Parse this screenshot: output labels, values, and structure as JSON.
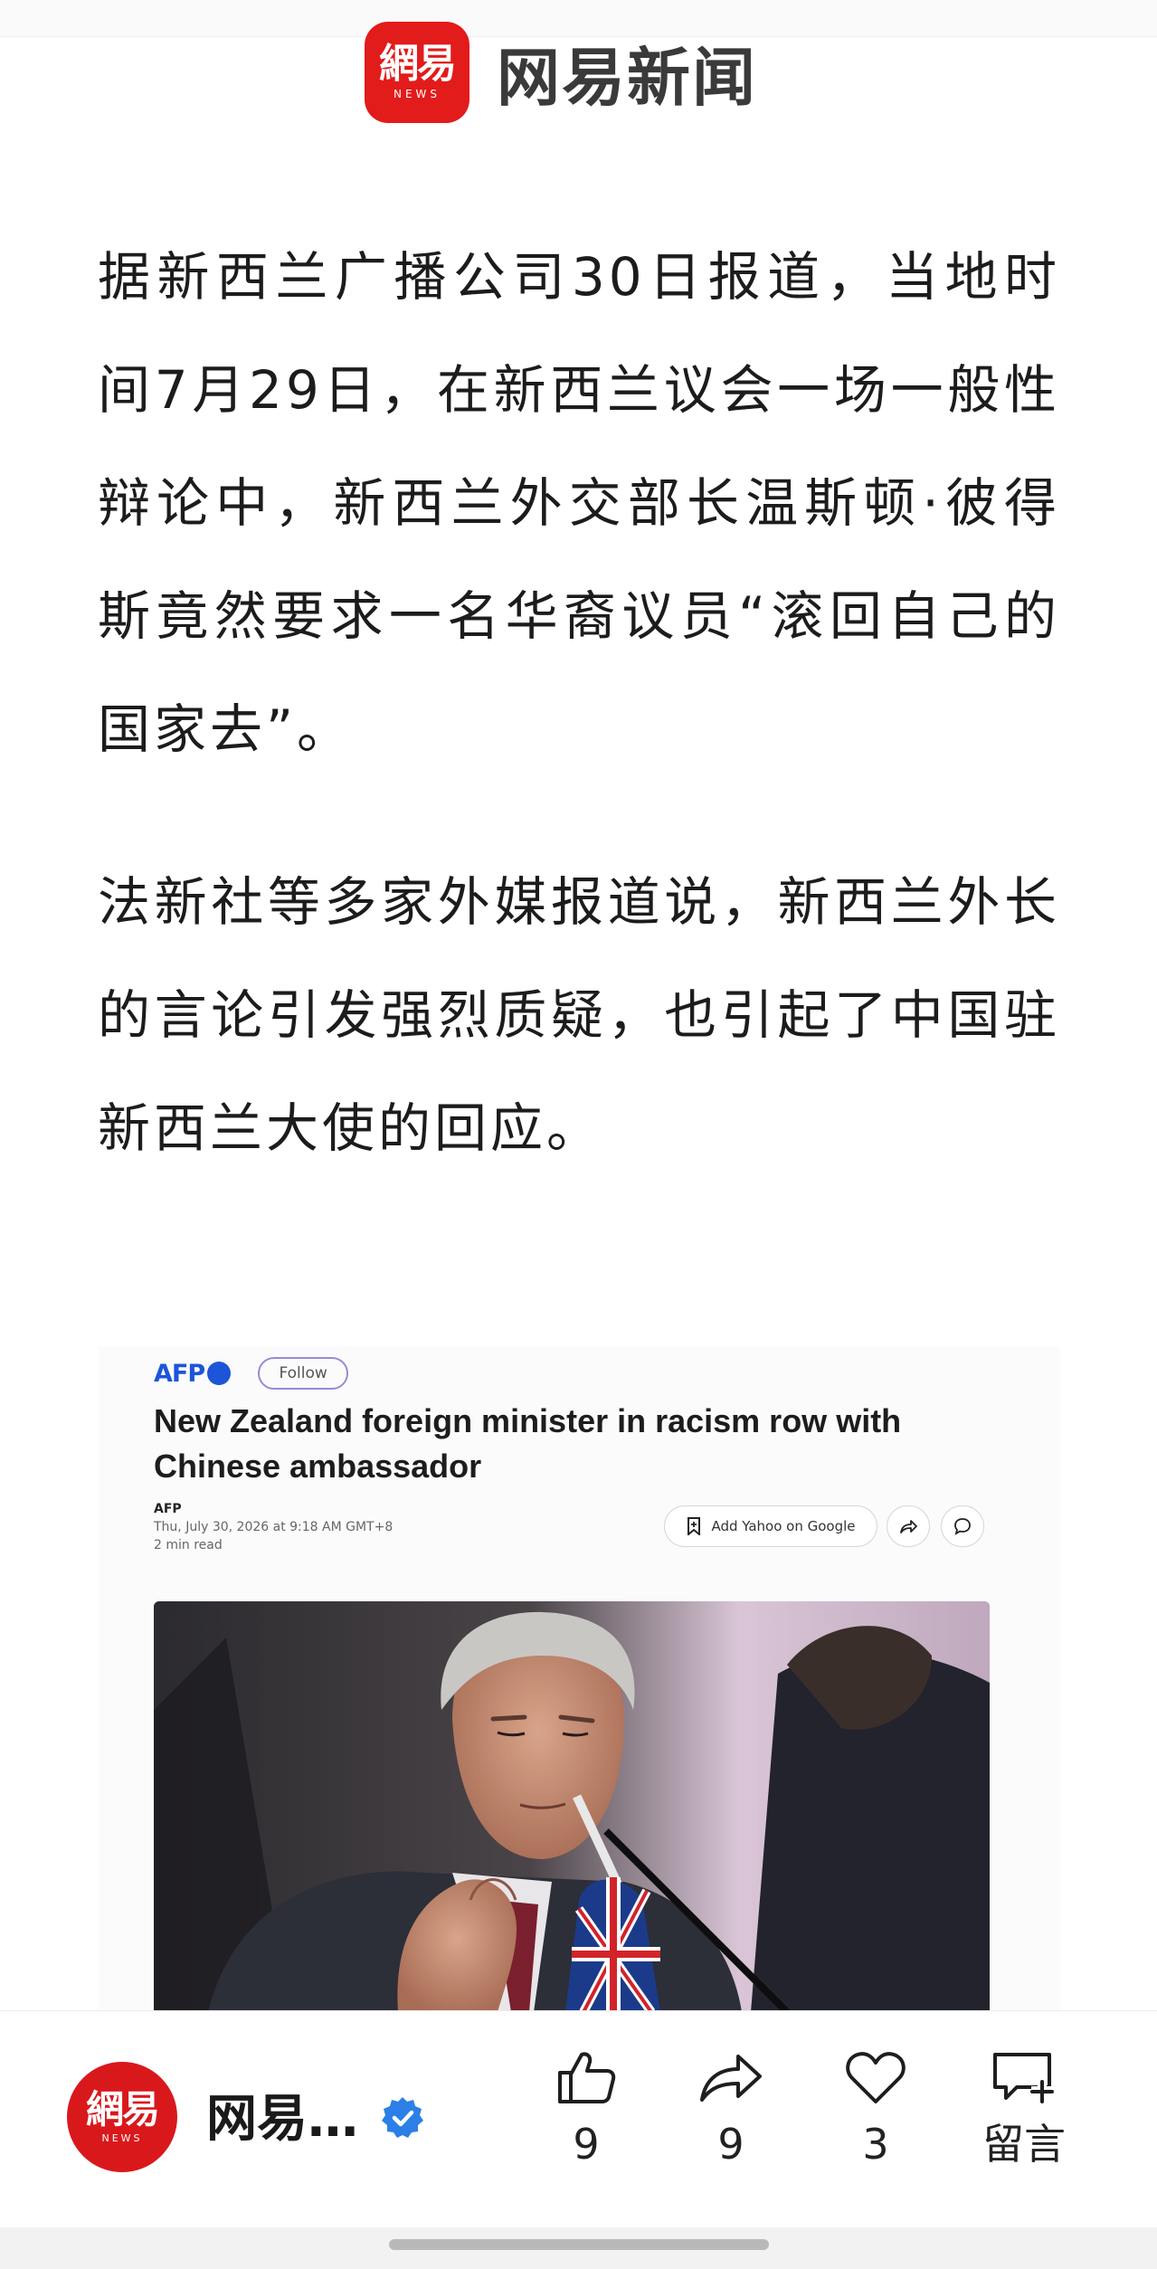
{
  "header": {
    "logo_cn": "網易",
    "logo_en": "NEWS",
    "brand_name": "网易新闻"
  },
  "article": {
    "paragraph_1": "据新西兰广播公司30日报道，当地时间7月29日，在新西兰议会一场一般性辩论中，新西兰外交部长温斯顿·彼得斯竟然要求一名华裔议员“滚回自己的国家去”。",
    "paragraph_2": "法新社等多家外媒报道说，新西兰外长的言论引发强烈质疑，也引起了中国驻新西兰大使的回应。"
  },
  "embedded_screenshot": {
    "publisher_logo": "AFP",
    "follow_label": "Follow",
    "headline": "New Zealand foreign minister in racism row with Chinese ambassador",
    "source": "AFP",
    "timestamp": "Thu, July 30, 2026 at 9:18 AM GMT+8",
    "read_time": "2 min read",
    "add_button_label": "Add Yahoo on Google"
  },
  "bottom_bar": {
    "avatar_cn": "網易",
    "avatar_en": "NEWS",
    "account_name": "网易…",
    "like_count": "9",
    "share_count": "9",
    "favorite_count": "3",
    "comment_label": "留言"
  },
  "colors": {
    "brand_red": "#e21b1b",
    "verified_blue": "#2b7fe6",
    "afp_blue": "#1d55d8"
  }
}
